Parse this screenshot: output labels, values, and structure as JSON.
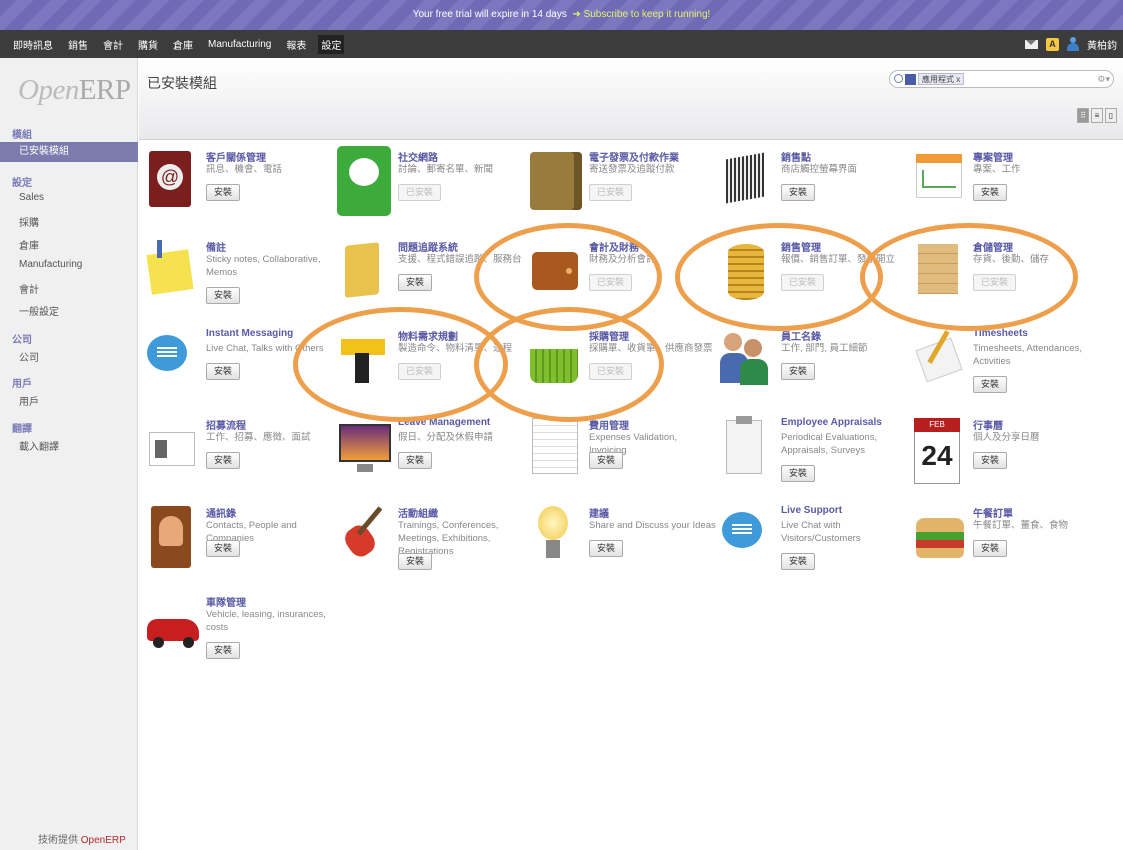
{
  "trial": {
    "text": "Your free trial will expire in 14 days",
    "link": "➜ Subscribe to keep it running!"
  },
  "top_menu": [
    "即時訊息",
    "銷售",
    "會計",
    "購貨",
    "倉庫",
    "Manufacturing",
    "報表",
    "設定"
  ],
  "user": {
    "name": "黃柏鈞"
  },
  "logo": {
    "main": "Open",
    "suffix": "ERP"
  },
  "sidebar": {
    "sections": [
      {
        "label": "模組",
        "items": [
          "已安裝模組"
        ]
      },
      {
        "label": "設定",
        "items": [
          "Sales",
          "採購",
          "倉庫",
          "Manufacturing",
          "會計",
          "一般設定"
        ]
      },
      {
        "label": "公司",
        "items": [
          "公司"
        ]
      },
      {
        "label": "用戶",
        "items": [
          "用戶"
        ]
      },
      {
        "label": "翻譯",
        "items": [
          "載入翻譯"
        ]
      }
    ],
    "powered_prefix": "技術提供",
    "powered_brand": "OpenERP"
  },
  "page_title": "已安裝模組",
  "search": {
    "facet": "應用程式",
    "facet_close": "x",
    "options": "⚙▾"
  },
  "view_switch": [
    "⠿",
    "≡",
    "▯"
  ],
  "modules": [
    {
      "title": "客戶關係管理",
      "desc": "訊息、機會、電話",
      "button": "安裝",
      "installed": false,
      "icon": "address-book-icon"
    },
    {
      "title": "社交網路",
      "desc": "討論、郵寄名單、新聞",
      "button": "已安裝",
      "installed": true,
      "icon": "chat-bubble-icon"
    },
    {
      "title": "電子發票及付款作業",
      "desc": "寄送發票及追蹤付款",
      "button": "已安裝",
      "installed": true,
      "icon": "wallet-icon"
    },
    {
      "title": "銷售點",
      "desc": "商店觸控螢幕界面",
      "button": "安裝",
      "installed": false,
      "icon": "barcode-icon"
    },
    {
      "title": "專案管理",
      "desc": "專案、工作",
      "button": "安裝",
      "installed": false,
      "icon": "calendar-chart-icon"
    },
    {
      "title": "備註",
      "desc": "Sticky notes, Collaborative, Memos",
      "button": "安裝",
      "installed": false,
      "icon": "sticky-note-icon"
    },
    {
      "title": "問題追蹤系統",
      "desc": "支援、程式錯誤追蹤、服務台",
      "button": "安裝",
      "installed": false,
      "icon": "folder-icon"
    },
    {
      "title": "會計及財務",
      "desc": "財務及分析會計",
      "button": "已安裝",
      "installed": true,
      "icon": "brown-wallet-icon"
    },
    {
      "title": "銷售管理",
      "desc": "報價、銷售訂單、發票開立",
      "button": "已安裝",
      "installed": true,
      "icon": "coins-icon"
    },
    {
      "title": "倉儲管理",
      "desc": "存貨、後勤、儲存",
      "button": "已安裝",
      "installed": true,
      "icon": "crate-icon"
    },
    {
      "title": "Instant Messaging",
      "desc": "Live Chat, Talks with Others",
      "button": "安裝",
      "installed": false,
      "icon": "speech-bubble-icon"
    },
    {
      "title": "物料需求規劃",
      "desc": "製造命令、物料清單、途程",
      "button": "已安裝",
      "installed": true,
      "icon": "drill-icon"
    },
    {
      "title": "採購管理",
      "desc": "採購單、收貨單、供應商發票",
      "button": "已安裝",
      "installed": true,
      "icon": "basket-icon"
    },
    {
      "title": "員工名錄",
      "desc": "工作, 部門, 員工細節",
      "button": "安裝",
      "installed": false,
      "icon": "people-icon"
    },
    {
      "title": "Timesheets",
      "desc": "Timesheets, Attendances, Activities",
      "button": "安裝",
      "installed": false,
      "icon": "pencil-paper-icon"
    },
    {
      "title": "招募流程",
      "desc": "工作、招募、應徵、面試",
      "button": "安裝",
      "installed": false,
      "icon": "contact-card-icon"
    },
    {
      "title": "Leave Management",
      "desc": "假日、分配及休假申請",
      "button": "安裝",
      "installed": false,
      "icon": "monitor-sunset-icon"
    },
    {
      "title": "費用管理",
      "desc": "Expenses Validation, Invoicing",
      "button": "安裝",
      "installed": false,
      "icon": "spreadsheet-icon"
    },
    {
      "title": "Employee Appraisals",
      "desc": "Periodical Evaluations, Appraisals, Surveys",
      "button": "安裝",
      "installed": false,
      "icon": "clipboard-icon"
    },
    {
      "title": "行事曆",
      "desc": "個人及分享日曆",
      "button": "安裝",
      "installed": false,
      "icon": "calendar-24-icon"
    },
    {
      "title": "通訊錄",
      "desc": "Contacts, People and Companies",
      "button": "安裝",
      "installed": false,
      "icon": "contacts-book-icon"
    },
    {
      "title": "活動組織",
      "desc": "Trainings, Conferences, Meetings, Exhibitions, Registrations",
      "button": "安裝",
      "installed": false,
      "icon": "guitar-icon"
    },
    {
      "title": "建議",
      "desc": "Share and Discuss your Ideas",
      "button": "安裝",
      "installed": false,
      "icon": "lightbulb-icon"
    },
    {
      "title": "Live Support",
      "desc": "Live Chat with Visitors/Customers",
      "button": "安裝",
      "installed": false,
      "icon": "support-bubble-icon"
    },
    {
      "title": "午餐訂單",
      "desc": "午餐訂單、薑食、食物",
      "button": "安裝",
      "installed": false,
      "icon": "sandwich-icon"
    },
    {
      "title": "車隊管理",
      "desc": "Vehicle, leasing, insurances, costs",
      "button": "安裝",
      "installed": false,
      "icon": "car-icon"
    }
  ],
  "colors": {
    "accent": "#7c7bad",
    "ring": "#ee9f4b",
    "title": "#5a5aa6"
  }
}
